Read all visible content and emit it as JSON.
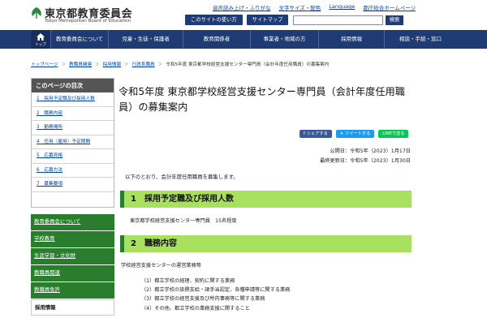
{
  "header": {
    "logo_title": "東京都教育委員会",
    "logo_sub": "Tokyo Metropolitan Board of Education",
    "util_links": [
      "音声読み上げ・ふりがな",
      "文字サイズ・配色",
      "Language",
      "都庁総合ホームページ"
    ],
    "buttons": [
      "このサイトの使い方",
      "サイトマップ"
    ],
    "search_label": "検索"
  },
  "gnav": {
    "home_label": "トップ",
    "items": [
      "教育委員会について",
      "児童・生徒・保護者",
      "教育関係者",
      "事業者・地域の方",
      "採用情報",
      "相談・手続・窓口"
    ]
  },
  "breadcrumb": [
    "トップページ",
    "教職員関連",
    "採用情報",
    "行政系職員",
    "令和5年度 東京都学校経営支援センター専門員（会計年度任用職員）の募集案内"
  ],
  "toc": {
    "title": "このページの目次",
    "items": [
      "1　採用予定職及び採用人数",
      "2　職務内容",
      "3　勤務場所",
      "4　任用（雇用）予定期間",
      "5　応募資格",
      "6　応募方法",
      "7　募集要項"
    ]
  },
  "side_menu": [
    "教育委員会について",
    "学校教育",
    "生涯学習・文化財",
    "教職員関連",
    "教職員免許",
    "採用情報"
  ],
  "main": {
    "title": "令和5年度 東京都学校経営支援センター専門員（会計年度任用職員）の募集案内",
    "share": [
      "シェアする",
      "ツイートする",
      "LINEで送る"
    ],
    "published": "公開日：令和5年（2023）1月17日",
    "updated": "最終更新日：令和5年（2023）1月30日",
    "lead": "以下のとおり、会計年度任用職員を募集します。",
    "sec1_title": "1　採用予定職及び採用人数",
    "sec1_body": "東京都学校経営支援センター専門員　15名程度",
    "sec2_title": "2　職務内容",
    "sec2_body": "学校経営支援センターの運営業務等",
    "duties": [
      "（1）都立学校の経理、契約に関する業務",
      "（2）都立学校の旅費支給・諸手当認定、各種申請等に関する業務",
      "（3）都立学校の経営支援及び所内事務等に関する業務",
      "（4）その他、都立学校の業務支援に関すること"
    ]
  },
  "colors": {
    "navy": "#1e3c73",
    "green": "#2a7d2d",
    "light_green": "#a8e05f",
    "toc_header": "#555555",
    "link": "#00449a"
  }
}
